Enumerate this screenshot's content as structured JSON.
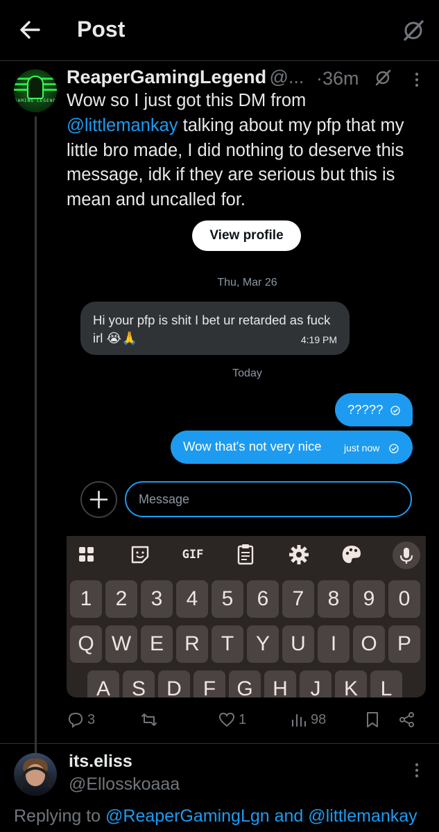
{
  "header": {
    "title": "Post"
  },
  "post": {
    "author_name": "ReaperGamingLegend",
    "author_handle": "@...",
    "time": "·36m",
    "text_part1": "Wow so I just got this DM from",
    "mention": "@littlemankay",
    "text_part2": "talking about my pfp that my little bro made, I did nothing to deserve this message, idk if they are serious but this is mean and uncalled for.",
    "avatar_label": "GAMING LEGEND"
  },
  "dm": {
    "view_profile_label": "View profile",
    "date_1": "Thu, Mar 26",
    "incoming_message": "Hi your pfp is shit I bet ur retarded as fuck irl 😭🙏",
    "incoming_time": "4:19 PM",
    "date_2": "Today",
    "outgoing_1": "?????",
    "outgoing_2": "Wow that's not very nice",
    "outgoing_2_time": "just now",
    "input_placeholder": "Message"
  },
  "keyboard": {
    "tools": [
      "apps-grid-icon",
      "sticker-icon",
      "gif-icon",
      "clipboard-icon",
      "settings-icon",
      "palette-icon",
      "mic-icon"
    ],
    "gif_label": "GIF",
    "number_row": [
      "1",
      "2",
      "3",
      "4",
      "5",
      "6",
      "7",
      "8",
      "9",
      "0"
    ],
    "qwerty_row": [
      "Q",
      "W",
      "E",
      "R",
      "T",
      "Y",
      "U",
      "I",
      "O",
      "P"
    ],
    "asdf_row": [
      "A",
      "S",
      "D",
      "F",
      "G",
      "H",
      "J",
      "K",
      "L"
    ]
  },
  "actions": {
    "replies": "3",
    "reposts": "",
    "likes": "1",
    "views": "98"
  },
  "reply": {
    "author_name": "its.eliss",
    "author_handle": "@Ellosskoaaa",
    "replying_prefix": "Replying to",
    "replying_to_1": "@ReaperGamingLgn",
    "replying_and": "and",
    "replying_to_2": "@littlemankay"
  }
}
